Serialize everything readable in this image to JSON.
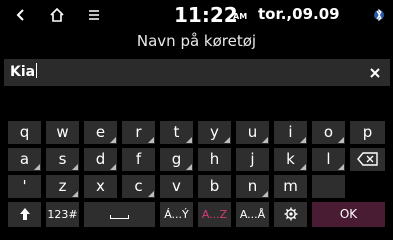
{
  "status": {
    "time": "11:22",
    "ampm": "AM",
    "date": "tor.,09.09"
  },
  "title": "Navn på køretøj",
  "input": {
    "value": "Kia"
  },
  "keyboard": {
    "row1": [
      "q",
      "w",
      "e",
      "r",
      "t",
      "y",
      "u",
      "i",
      "o",
      "p"
    ],
    "row2": [
      "a",
      "s",
      "d",
      "f",
      "g",
      "h",
      "j",
      "k",
      "l"
    ],
    "row3": [
      "'",
      "z",
      "x",
      "c",
      "v",
      "b",
      "n",
      "m"
    ],
    "bottom": {
      "num": "123#",
      "accent_lower": "Á...Ý",
      "case": "A...Z",
      "accent_upper": "A...Å",
      "ok": "OK"
    }
  },
  "colors": {
    "accent": "#d63a77",
    "key": "#2e2e2e",
    "ok": "#4a1c33"
  }
}
